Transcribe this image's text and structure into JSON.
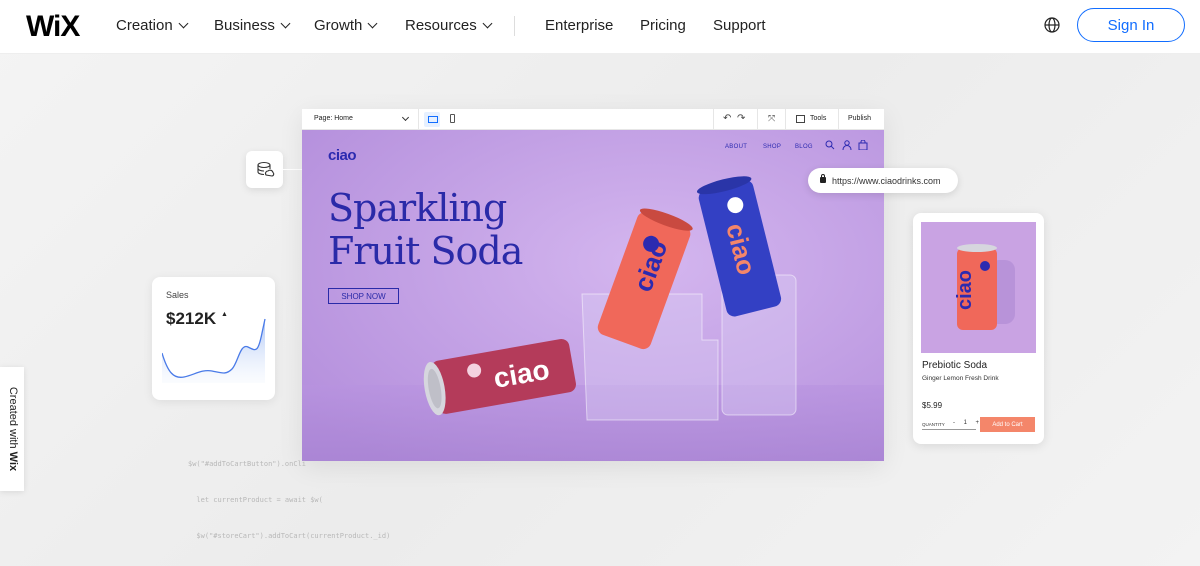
{
  "nav": {
    "logo": "WiX",
    "items": [
      {
        "label": "Creation",
        "dropdown": true
      },
      {
        "label": "Business",
        "dropdown": true
      },
      {
        "label": "Growth",
        "dropdown": true
      },
      {
        "label": "Resources",
        "dropdown": true
      },
      {
        "label": "Enterprise",
        "dropdown": false
      },
      {
        "label": "Pricing",
        "dropdown": false
      },
      {
        "label": "Support",
        "dropdown": false
      }
    ],
    "globe_icon": "globe-icon",
    "signin_label": "Sign In"
  },
  "editor": {
    "toolbar": {
      "page_label": "Page: Home",
      "tools_label": "Tools",
      "publish_label": "Publish"
    },
    "site": {
      "logo": "ciao",
      "nav": [
        "ABOUT",
        "SHOP",
        "BLOG"
      ],
      "hero_line1": "Sparkling",
      "hero_line2": "Fruit Soda",
      "shop_button": "SHOP NOW",
      "can_text": "ciao"
    }
  },
  "url_bar": {
    "url": "https://www.ciaodrinks.com"
  },
  "sales_widget": {
    "label": "Sales",
    "value": "$212K"
  },
  "code_snippet": [
    "$w(\"#addToCartButton\").onCli",
    "  let currentProduct = await $w(",
    "  $w(\"#storeCart\").addToCart(currentProduct._id)",
    "})"
  ],
  "product_widget": {
    "name": "Prebiotic Soda",
    "description": "Ginger Lemon Fresh Drink",
    "price": "$5.99",
    "quantity_label": "QUANTITY",
    "quantity_minus": "-",
    "quantity_value": "1",
    "quantity_plus": "+",
    "add_to_cart_label": "Add to Cart"
  },
  "created_with": {
    "prefix": "Created with",
    "brand": "Wix"
  },
  "colors": {
    "accent": "#116dff",
    "editor_bg": "#c9a6e8",
    "brand_blue": "#2a2aa8",
    "cta": "#f4866a"
  }
}
